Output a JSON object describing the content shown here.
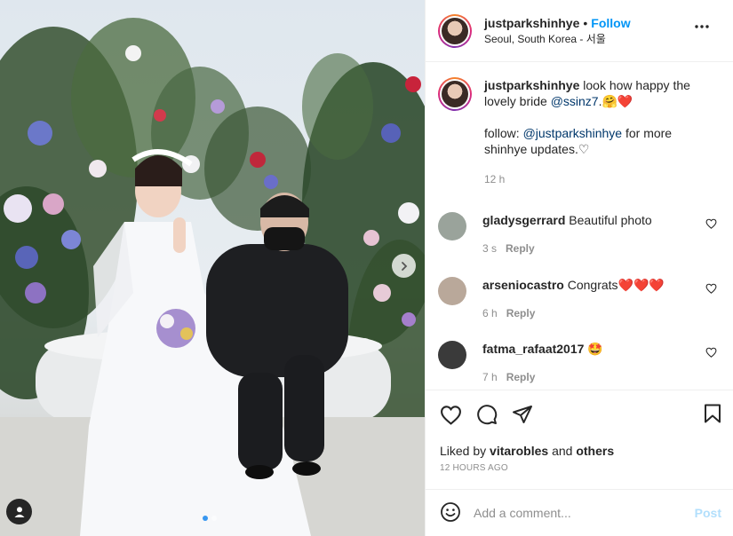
{
  "post": {
    "username": "justparkshinhye",
    "follow_label": "Follow",
    "location": "Seoul, South Korea - 서울"
  },
  "caption": {
    "username": "justparkshinhye",
    "text_1": " look how happy the lovely bride ",
    "mention_1": "@ssinz7",
    "text_2": ".",
    "emoji_1": "🤗❤️",
    "text_3": "follow: ",
    "mention_2": "@justparkshinhye",
    "text_4": " for more shinhye updates.♡",
    "time": "12 h"
  },
  "comments": [
    {
      "username": "gladysgerrard",
      "text": "Beautiful photo",
      "time": "3 s",
      "reply_label": "Reply",
      "avatar_color": "#9aa39b"
    },
    {
      "username": "arseniocastro",
      "text": "Congrats❤️❤️❤️",
      "time": "6 h",
      "reply_label": "Reply",
      "avatar_color": "#b9a89a"
    },
    {
      "username": "fatma_rafaat2017",
      "text": "🤩",
      "time": "7 h",
      "reply_label": "Reply",
      "avatar_color": "#3a3a3a"
    }
  ],
  "icons": {
    "more": "more-horizontal-icon",
    "like": "heart-icon",
    "comment": "comment-icon",
    "share": "paper-plane-icon",
    "save": "bookmark-icon",
    "emoji": "smiley-icon",
    "user_tag": "user-tag-icon",
    "next": "chevron-right-icon"
  },
  "likes": {
    "prefix": "Liked by ",
    "user": "vitarobles",
    "middle": " and ",
    "others": "others"
  },
  "timestamp": "12 HOURS AGO",
  "add_comment": {
    "placeholder": "Add a comment...",
    "post_label": "Post"
  },
  "carousel": {
    "slides": 2,
    "active_index": 0
  },
  "colors": {
    "follow_blue": "#0095f6",
    "post_disabled": "#b2dffc",
    "mention": "#00376b",
    "muted": "#8e8e8e"
  }
}
